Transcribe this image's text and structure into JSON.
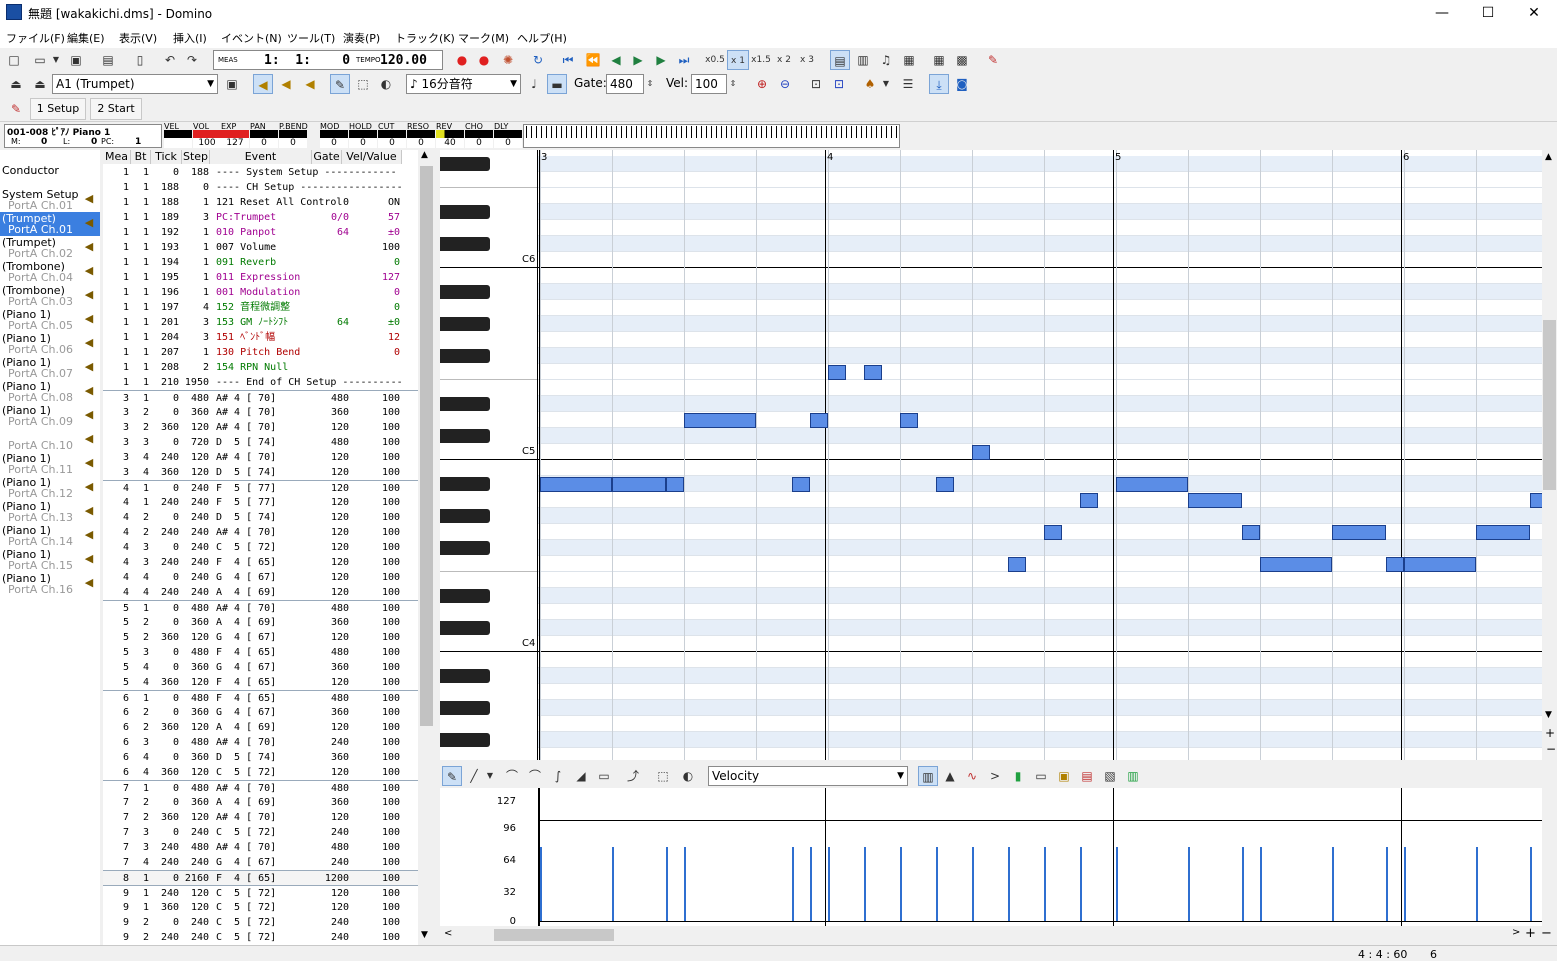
{
  "title": "無題 [wakakichi.dms] - Domino",
  "window_controls": {
    "min": "—",
    "max": "☐",
    "close": "✕"
  },
  "menu": [
    "ファイル(F)",
    "編集(E)",
    "表示(V)",
    "挿入(I)",
    "イベント(N)",
    "ツール(T)",
    "演奏(P)",
    "トラック(K)",
    "マーク(M)",
    "ヘルプ(H)"
  ],
  "toolbar1": {
    "meas_label": "MEAS",
    "position": "1:  1:    0",
    "tempo_label": "TEMPO",
    "tempo": "120.00",
    "speeds": [
      "x0.5",
      "x 1",
      "x1.5",
      "x 2",
      "x 3"
    ]
  },
  "toolbar2": {
    "instrument": "A1  (Trumpet)",
    "note_len": "♪ 16分音符",
    "gate_label": "Gate:",
    "gate": "480",
    "vel_label": "Vel:",
    "vel": "100"
  },
  "tabs": [
    "1 Setup",
    "2 Start"
  ],
  "status": {
    "patch": "001-008 ﾋﾟｱﾉ Piano 1",
    "m_label": "M:",
    "m": "0",
    "l_label": "L:",
    "l": "0",
    "pc_label": "PC:",
    "pc": "1",
    "meters": [
      {
        "name": "VEL",
        "value": ""
      },
      {
        "name": "VOL",
        "value": "100"
      },
      {
        "name": "EXP",
        "value": "127"
      },
      {
        "name": "PAN",
        "value": "0"
      },
      {
        "name": "P.BEND",
        "value": "0"
      },
      {
        "name": "MOD",
        "value": "0"
      },
      {
        "name": "HOLD",
        "value": "0"
      },
      {
        "name": "CUT",
        "value": "0"
      },
      {
        "name": "RESO",
        "value": "0"
      },
      {
        "name": "REV",
        "value": "40"
      },
      {
        "name": "CHO",
        "value": "0"
      },
      {
        "name": "DLY",
        "value": "0"
      }
    ]
  },
  "tracks": [
    {
      "name": "Conductor",
      "port": ""
    },
    {
      "name": "System Setup",
      "port": "PortA  Ch.01"
    },
    {
      "name": "(Trumpet)",
      "port": "PortA  Ch.01"
    },
    {
      "name": "(Trumpet)",
      "port": "PortA  Ch.02"
    },
    {
      "name": "(Trombone)",
      "port": "PortA  Ch.04"
    },
    {
      "name": "(Trombone)",
      "port": "PortA  Ch.03"
    },
    {
      "name": "(Piano 1)",
      "port": "PortA  Ch.05"
    },
    {
      "name": "(Piano 1)",
      "port": "PortA  Ch.06"
    },
    {
      "name": "(Piano 1)",
      "port": "PortA  Ch.07"
    },
    {
      "name": "(Piano 1)",
      "port": "PortA  Ch.08"
    },
    {
      "name": "(Piano 1)",
      "port": "PortA  Ch.09"
    },
    {
      "name": "",
      "port": "PortA  Ch.10"
    },
    {
      "name": "(Piano 1)",
      "port": "PortA  Ch.11"
    },
    {
      "name": "(Piano 1)",
      "port": "PortA  Ch.12"
    },
    {
      "name": "(Piano 1)",
      "port": "PortA  Ch.13"
    },
    {
      "name": "(Piano 1)",
      "port": "PortA  Ch.14"
    },
    {
      "name": "(Piano 1)",
      "port": "PortA  Ch.15"
    },
    {
      "name": "(Piano 1)",
      "port": "PortA  Ch.16"
    }
  ],
  "event_headers": [
    "Mea",
    "Bt",
    "Tick",
    "Step",
    "Event",
    "Gate",
    "Vel/Value"
  ],
  "events": [
    [
      "1",
      "1",
      "0",
      "188",
      "---- System Setup ------------",
      "",
      "",
      ""
    ],
    [
      "1",
      "1",
      "188",
      "0",
      "---- CH Setup -----------------",
      "",
      "",
      ""
    ],
    [
      "1",
      "1",
      "188",
      "1",
      "121 Reset All Control",
      "0",
      "ON",
      ""
    ],
    [
      "1",
      "1",
      "189",
      "3",
      "PC:Trumpet",
      "0/0",
      "57",
      "p"
    ],
    [
      "1",
      "1",
      "192",
      "1",
      "010 Panpot",
      "64",
      "±0",
      "p"
    ],
    [
      "1",
      "1",
      "193",
      "1",
      "007 Volume",
      "",
      "100",
      ""
    ],
    [
      "1",
      "1",
      "194",
      "1",
      "091 Reverb",
      "",
      "0",
      "g"
    ],
    [
      "1",
      "1",
      "195",
      "1",
      "011 Expression",
      "",
      "127",
      "p"
    ],
    [
      "1",
      "1",
      "196",
      "1",
      "001 Modulation",
      "",
      "0",
      "p"
    ],
    [
      "1",
      "1",
      "197",
      "4",
      "152 音程微調整",
      "",
      "0",
      "g"
    ],
    [
      "1",
      "1",
      "201",
      "3",
      "153 GM ﾉｰﾄｼﾌﾄ",
      "64",
      "±0",
      "g"
    ],
    [
      "1",
      "1",
      "204",
      "3",
      "151 ﾍﾞﾝﾄﾞ幅",
      "",
      "12",
      "r"
    ],
    [
      "1",
      "1",
      "207",
      "1",
      "130 Pitch Bend",
      "",
      "0",
      "r"
    ],
    [
      "1",
      "1",
      "208",
      "2",
      "154 RPN Null",
      "",
      "",
      "g"
    ],
    [
      "1",
      "1",
      "210",
      "1950",
      "---- End of CH Setup ----------",
      "",
      "",
      ""
    ],
    [
      "3",
      "1",
      "0",
      "480",
      "A# 4 [ 70]",
      "480",
      "100",
      ""
    ],
    [
      "3",
      "2",
      "0",
      "360",
      "A# 4 [ 70]",
      "360",
      "100",
      ""
    ],
    [
      "3",
      "2",
      "360",
      "120",
      "A# 4 [ 70]",
      "120",
      "100",
      ""
    ],
    [
      "3",
      "3",
      "0",
      "720",
      "D  5 [ 74]",
      "480",
      "100",
      ""
    ],
    [
      "3",
      "4",
      "240",
      "120",
      "A# 4 [ 70]",
      "120",
      "100",
      ""
    ],
    [
      "3",
      "4",
      "360",
      "120",
      "D  5 [ 74]",
      "120",
      "100",
      ""
    ],
    [
      "4",
      "1",
      "0",
      "240",
      "F  5 [ 77]",
      "120",
      "100",
      ""
    ],
    [
      "4",
      "1",
      "240",
      "240",
      "F  5 [ 77]",
      "120",
      "100",
      ""
    ],
    [
      "4",
      "2",
      "0",
      "240",
      "D  5 [ 74]",
      "120",
      "100",
      ""
    ],
    [
      "4",
      "2",
      "240",
      "240",
      "A# 4 [ 70]",
      "120",
      "100",
      ""
    ],
    [
      "4",
      "3",
      "0",
      "240",
      "C  5 [ 72]",
      "120",
      "100",
      ""
    ],
    [
      "4",
      "3",
      "240",
      "240",
      "F  4 [ 65]",
      "120",
      "100",
      ""
    ],
    [
      "4",
      "4",
      "0",
      "240",
      "G  4 [ 67]",
      "120",
      "100",
      ""
    ],
    [
      "4",
      "4",
      "240",
      "240",
      "A  4 [ 69]",
      "120",
      "100",
      ""
    ],
    [
      "5",
      "1",
      "0",
      "480",
      "A# 4 [ 70]",
      "480",
      "100",
      ""
    ],
    [
      "5",
      "2",
      "0",
      "360",
      "A  4 [ 69]",
      "360",
      "100",
      ""
    ],
    [
      "5",
      "2",
      "360",
      "120",
      "G  4 [ 67]",
      "120",
      "100",
      ""
    ],
    [
      "5",
      "3",
      "0",
      "480",
      "F  4 [ 65]",
      "480",
      "100",
      ""
    ],
    [
      "5",
      "4",
      "0",
      "360",
      "G  4 [ 67]",
      "360",
      "100",
      ""
    ],
    [
      "5",
      "4",
      "360",
      "120",
      "F  4 [ 65]",
      "120",
      "100",
      ""
    ],
    [
      "6",
      "1",
      "0",
      "480",
      "F  4 [ 65]",
      "480",
      "100",
      ""
    ],
    [
      "6",
      "2",
      "0",
      "360",
      "G  4 [ 67]",
      "360",
      "100",
      ""
    ],
    [
      "6",
      "2",
      "360",
      "120",
      "A  4 [ 69]",
      "120",
      "100",
      ""
    ],
    [
      "6",
      "3",
      "0",
      "480",
      "A# 4 [ 70]",
      "240",
      "100",
      ""
    ],
    [
      "6",
      "4",
      "0",
      "360",
      "D  5 [ 74]",
      "360",
      "100",
      ""
    ],
    [
      "6",
      "4",
      "360",
      "120",
      "C  5 [ 72]",
      "120",
      "100",
      ""
    ],
    [
      "7",
      "1",
      "0",
      "480",
      "A# 4 [ 70]",
      "480",
      "100",
      ""
    ],
    [
      "7",
      "2",
      "0",
      "360",
      "A  4 [ 69]",
      "360",
      "100",
      ""
    ],
    [
      "7",
      "2",
      "360",
      "120",
      "A# 4 [ 70]",
      "120",
      "100",
      ""
    ],
    [
      "7",
      "3",
      "0",
      "240",
      "C  5 [ 72]",
      "240",
      "100",
      ""
    ],
    [
      "7",
      "3",
      "240",
      "480",
      "A# 4 [ 70]",
      "480",
      "100",
      ""
    ],
    [
      "7",
      "4",
      "240",
      "240",
      "G  4 [ 67]",
      "240",
      "100",
      ""
    ],
    [
      "8",
      "1",
      "0",
      "2160",
      "F  4 [ 65]",
      "1200",
      "100",
      ""
    ],
    [
      "9",
      "1",
      "240",
      "120",
      "C  5 [ 72]",
      "120",
      "100",
      ""
    ],
    [
      "9",
      "1",
      "360",
      "120",
      "C  5 [ 72]",
      "120",
      "100",
      ""
    ],
    [
      "9",
      "2",
      "0",
      "240",
      "C  5 [ 72]",
      "240",
      "100",
      ""
    ],
    [
      "9",
      "2",
      "240",
      "240",
      "C  5 [ 72]",
      "240",
      "100",
      ""
    ]
  ],
  "piano_labels": [
    "C6",
    "C5",
    "C4"
  ],
  "measures": [
    "3",
    "4",
    "5",
    "6"
  ],
  "control": {
    "param": "Velocity",
    "ticks": [
      "127",
      "96",
      "64",
      "32",
      "0"
    ]
  },
  "statusbar": {
    "pos": "4 : 4 : 60",
    "meas": "6"
  },
  "colors": {
    "note": "#5b8de6",
    "selected_track": "#3b7fe0",
    "velocity": "#2f6fd0"
  }
}
